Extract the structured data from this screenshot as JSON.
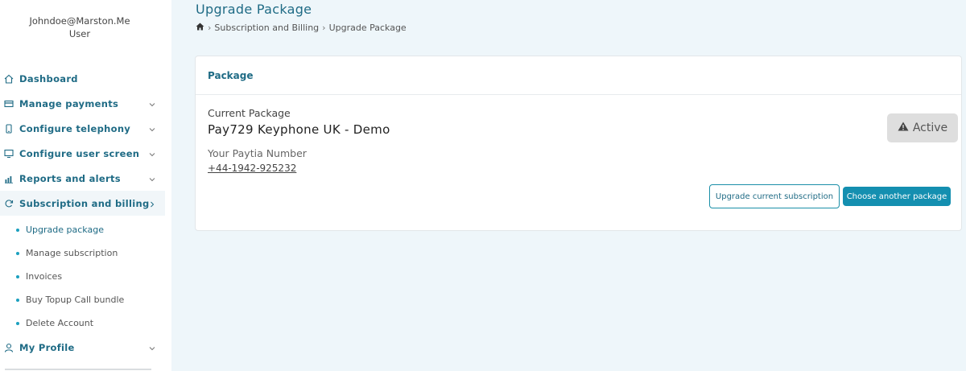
{
  "user": {
    "email": "Johndoe@Marston.Me",
    "role": "User"
  },
  "sidebar": {
    "items": [
      {
        "label": "Dashboard",
        "icon": "home-icon"
      },
      {
        "label": "Manage payments",
        "icon": "card-icon"
      },
      {
        "label": "Configure telephony",
        "icon": "phone-icon"
      },
      {
        "label": "Configure user screen",
        "icon": "monitor-icon"
      },
      {
        "label": "Reports and alerts",
        "icon": "bar-chart-icon"
      },
      {
        "label": "Subscription and billing",
        "icon": "refresh-icon"
      }
    ],
    "sub_items": [
      {
        "label": "Upgrade package"
      },
      {
        "label": "Manage subscription"
      },
      {
        "label": "Invoices"
      },
      {
        "label": "Buy Topup Call bundle"
      },
      {
        "label": "Delete Account"
      }
    ],
    "profile": {
      "label": "My Profile",
      "icon": "user-icon"
    }
  },
  "header": {
    "title": "Upgrade Package",
    "breadcrumb": [
      "Subscription and Billing",
      "Upgrade Package"
    ]
  },
  "card": {
    "title": "Package",
    "current_package_label": "Current Package",
    "current_package_value": "Pay729 Keyphone UK - Demo",
    "number_label": "Your Paytia Number",
    "number_value": "+44-1942-925232",
    "status": "Active",
    "upgrade_button": "Upgrade current subscription",
    "choose_button": "Choose another package"
  },
  "colors": {
    "accent": "#1f6b85",
    "button": "#148fb0",
    "background": "#eef6fa"
  }
}
